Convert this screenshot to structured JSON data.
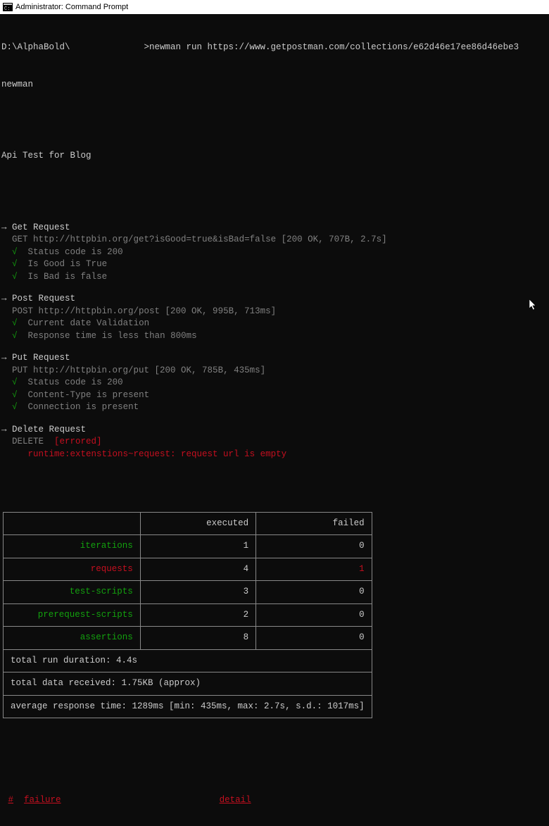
{
  "window": {
    "title": "Administrator: Command Prompt"
  },
  "prompt": {
    "path_before": "D:\\AlphaBold\\",
    "command": ">newman run https://www.getpostman.com/collections/e62d46e17ee86d46ebe3",
    "tool": "newman"
  },
  "suite_title": "Api Test for Blog",
  "requests": [
    {
      "name": "Get Request",
      "method": "GET",
      "url": "http://httpbin.org/get?isGood=true&isBad=false",
      "status": "[200 OK, 707B, 2.7s]",
      "errored": false,
      "assertions": [
        {
          "pass": true,
          "text": "Status code is 200"
        },
        {
          "pass": true,
          "text": "Is Good is True"
        },
        {
          "pass": true,
          "text": "Is Bad is false"
        }
      ]
    },
    {
      "name": "Post Request",
      "method": "POST",
      "url": "http://httpbin.org/post",
      "status": "[200 OK, 995B, 713ms]",
      "errored": false,
      "assertions": [
        {
          "pass": true,
          "text": "Current date Validation"
        },
        {
          "pass": true,
          "text": "Response time is less than 800ms"
        }
      ]
    },
    {
      "name": "Put Request",
      "method": "PUT",
      "url": "http://httpbin.org/put",
      "status": "[200 OK, 785B, 435ms]",
      "errored": false,
      "assertions": [
        {
          "pass": true,
          "text": "Status code is 200"
        },
        {
          "pass": true,
          "text": "Content-Type is present"
        },
        {
          "pass": true,
          "text": "Connection is present"
        }
      ]
    },
    {
      "name": "Delete Request",
      "method": "DELETE",
      "url": "",
      "status": "",
      "errored": true,
      "error_label": "[errored]",
      "error_text": "runtime:extenstions~request: request url is empty",
      "assertions": []
    }
  ],
  "summary": {
    "headers": {
      "executed": "executed",
      "failed": "failed"
    },
    "rows": [
      {
        "label": "iterations",
        "color": "green",
        "executed": "1",
        "failed": "0",
        "failed_red": false
      },
      {
        "label": "requests",
        "color": "red",
        "executed": "4",
        "failed": "1",
        "failed_red": true
      },
      {
        "label": "test-scripts",
        "color": "green",
        "executed": "3",
        "failed": "0",
        "failed_red": false
      },
      {
        "label": "prerequest-scripts",
        "color": "green",
        "executed": "2",
        "failed": "0",
        "failed_red": false
      },
      {
        "label": "assertions",
        "color": "green",
        "executed": "8",
        "failed": "0",
        "failed_red": false
      }
    ],
    "footer": [
      "total run duration: 4.4s",
      "total data received: 1.75KB (approx)",
      "average response time: 1289ms [min: 435ms, max: 2.7s, s.d.: 1017ms]"
    ]
  },
  "failures": {
    "hash": "#",
    "failure_label": "failure",
    "detail_label": "detail"
  }
}
